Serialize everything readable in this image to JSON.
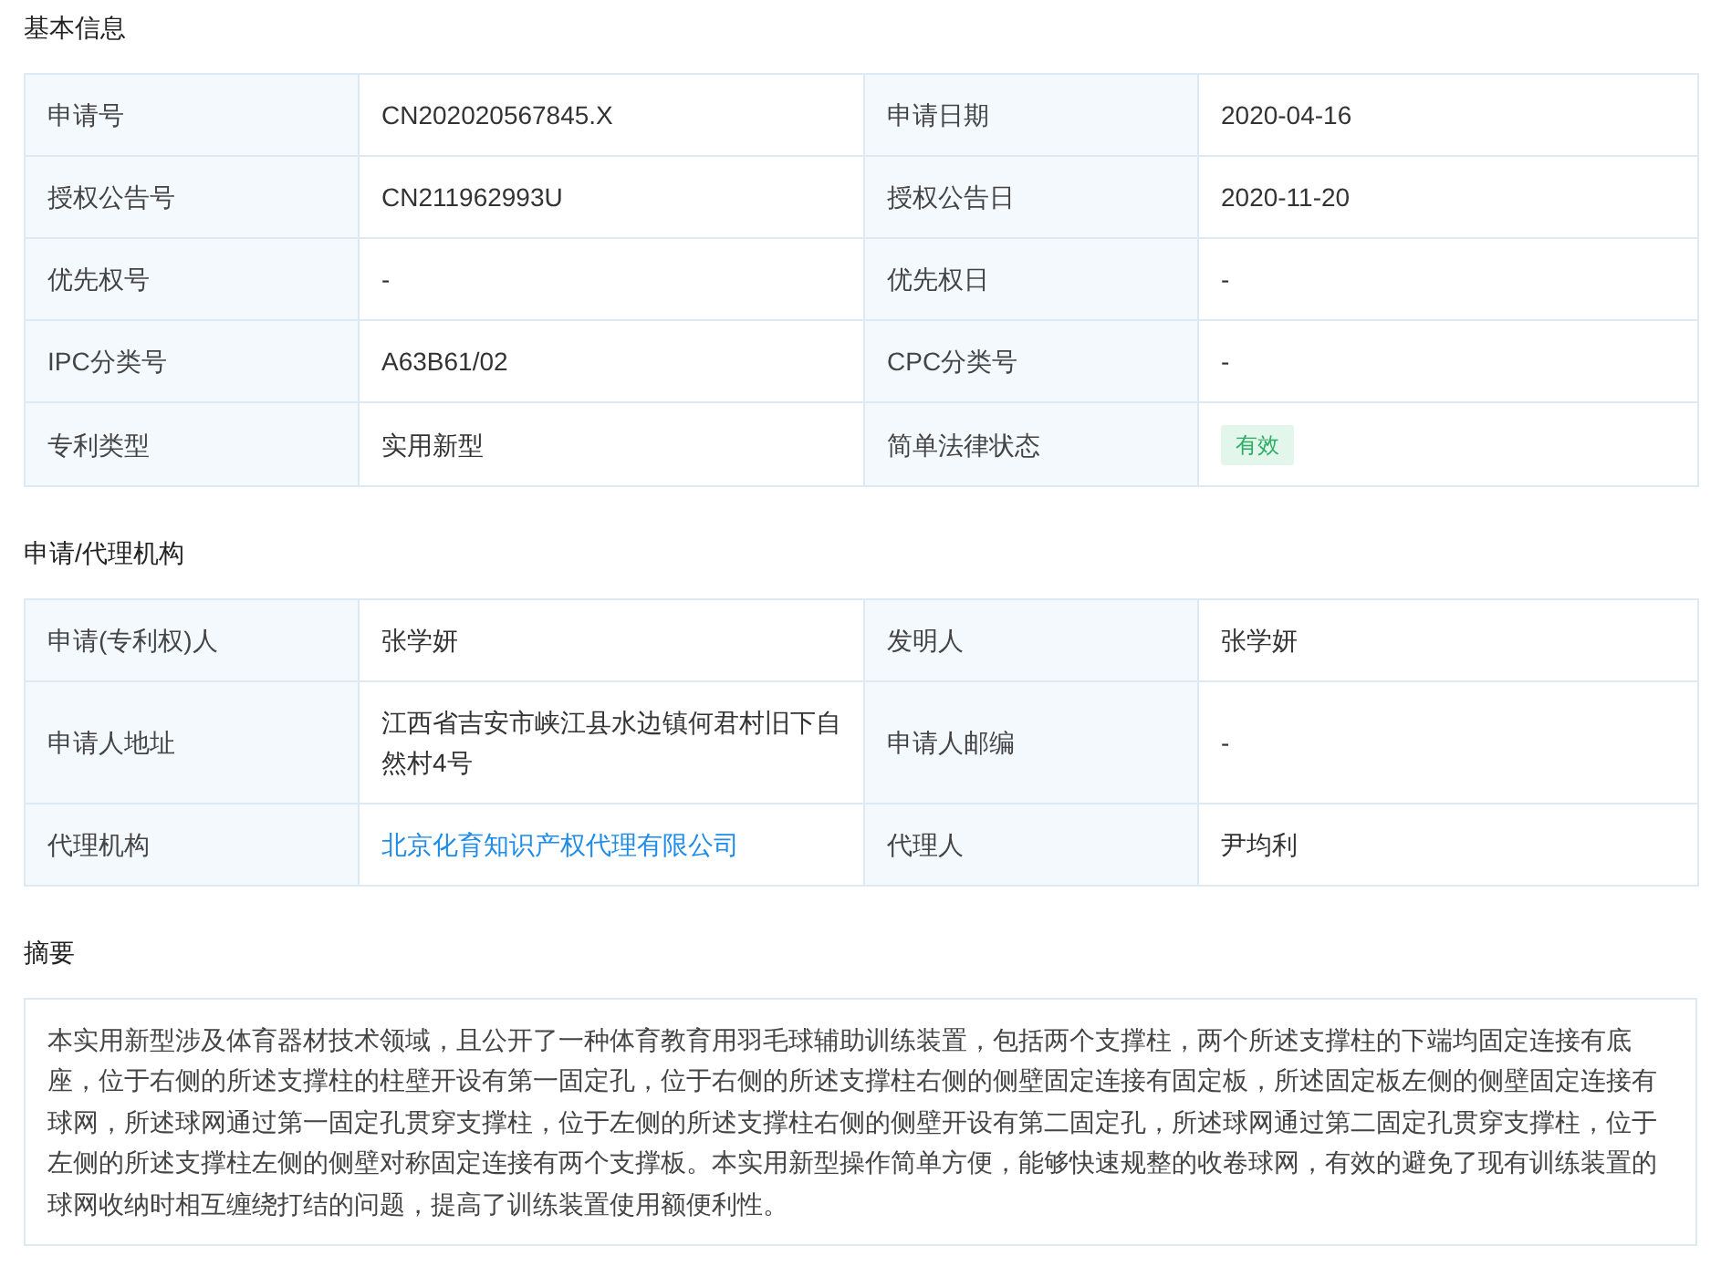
{
  "sections": [
    {
      "title": "基本信息",
      "rows": [
        [
          {
            "label": "申请号",
            "value": "CN202020567845.X",
            "kind": "text"
          },
          {
            "label": "申请日期",
            "value": "2020-04-16",
            "kind": "text"
          }
        ],
        [
          {
            "label": "授权公告号",
            "value": "CN211962993U",
            "kind": "text"
          },
          {
            "label": "授权公告日",
            "value": "2020-11-20",
            "kind": "text"
          }
        ],
        [
          {
            "label": "优先权号",
            "value": "-",
            "kind": "text"
          },
          {
            "label": "优先权日",
            "value": "-",
            "kind": "text"
          }
        ],
        [
          {
            "label": "IPC分类号",
            "value": "A63B61/02",
            "kind": "text"
          },
          {
            "label": "CPC分类号",
            "value": "-",
            "kind": "text"
          }
        ],
        [
          {
            "label": "专利类型",
            "value": "实用新型",
            "kind": "text"
          },
          {
            "label": "简单法律状态",
            "value": "有效",
            "kind": "tag"
          }
        ]
      ]
    },
    {
      "title": "申请/代理机构",
      "rows": [
        [
          {
            "label": "申请(专利权)人",
            "value": "张学妍",
            "kind": "text"
          },
          {
            "label": "发明人",
            "value": "张学妍",
            "kind": "text"
          }
        ],
        [
          {
            "label": "申请人地址",
            "value": "江西省吉安市峡江县水边镇何君村旧下自然村4号",
            "kind": "text"
          },
          {
            "label": "申请人邮编",
            "value": "-",
            "kind": "text"
          }
        ],
        [
          {
            "label": "代理机构",
            "value": "北京化育知识产权代理有限公司",
            "kind": "link"
          },
          {
            "label": "代理人",
            "value": "尹均利",
            "kind": "text"
          }
        ]
      ]
    }
  ],
  "abstract": {
    "title": "摘要",
    "text": "本实用新型涉及体育器材技术领域，且公开了一种体育教育用羽毛球辅助训练装置，包括两个支撑柱，两个所述支撑柱的下端均固定连接有底座，位于右侧的所述支撑柱的柱壁开设有第一固定孔，位于右侧的所述支撑柱右侧的侧壁固定连接有固定板，所述固定板左侧的侧壁固定连接有球网，所述球网通过第一固定孔贯穿支撑柱，位于左侧的所述支撑柱右侧的侧壁开设有第二固定孔，所述球网通过第二固定孔贯穿支撑柱，位于左侧的所述支撑柱左侧的侧壁对称固定连接有两个支撑板。本实用新型操作简单方便，能够快速规整的收卷球网，有效的避免了现有训练装置的球网收纳时相互缠绕打结的问题，提高了训练装置使用额便利性。"
  }
}
